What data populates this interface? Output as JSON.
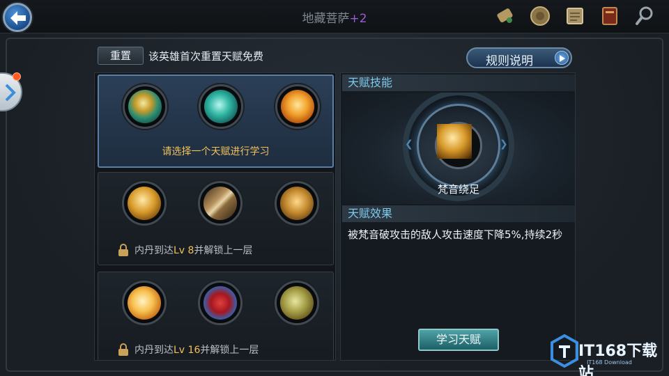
{
  "header": {
    "title": "地藏菩萨",
    "title_suffix": "+2",
    "icons": [
      "scroll-icon",
      "shield-coin-icon",
      "map-icon",
      "book-icon",
      "magnifier-icon"
    ]
  },
  "reset": {
    "button_label": "重置",
    "note": "该英雄首次重置天赋免费"
  },
  "rules_button_label": "规则说明",
  "tiers": [
    {
      "talents": [
        "jade-lotus-icon",
        "wave-icon",
        "fire-monk-icon"
      ],
      "hint": "请选择一个天赋进行学习",
      "locked": false
    },
    {
      "talents": [
        "gold-lotus-icon",
        "blade-icon",
        "shield-icon"
      ],
      "lock_prefix": "内丹到达",
      "lock_level": "Lv 8",
      "lock_suffix": "并解锁上一层",
      "locked": true
    },
    {
      "talents": [
        "burst-icon",
        "dragon-icon",
        "leaf-icon"
      ],
      "lock_prefix": "内丹到达",
      "lock_level": "Lv 16",
      "lock_suffix": "并解锁上一层",
      "locked": true
    }
  ],
  "detail": {
    "skill_header": "天赋技能",
    "skill_name": "梵音绕足",
    "effect_header": "天赋效果",
    "effect_text": "被梵音破攻击的敌人攻击速度下降5%,持续2秒",
    "learn_button": "学习天赋"
  },
  "watermark": {
    "text": "IT168下载站",
    "sub": "IT168 Download"
  }
}
